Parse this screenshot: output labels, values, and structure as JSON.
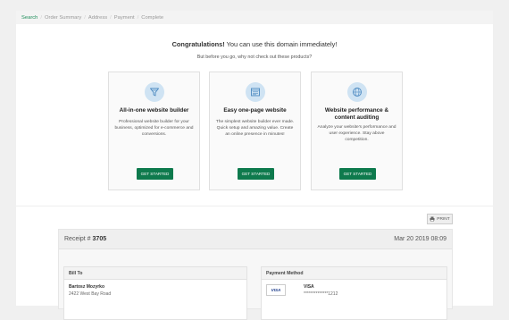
{
  "breadcrumb": [
    "Search",
    "Order Summary",
    "Address",
    "Payment",
    "Complete"
  ],
  "congrats": {
    "bold": "Congratulations!",
    "rest": " You can use this domain immediately!",
    "subline": "But before you go, why not check out these products?"
  },
  "cards": [
    {
      "icon": "funnel-icon",
      "title": "All-in-one website builder",
      "description": "Professional website builder for your business, optimized for e-commerce and conversions.",
      "button": "GET STARTED"
    },
    {
      "icon": "layout-icon",
      "title": "Easy one-page website",
      "description": "The simplest website builder ever made. Quick setup and amazing value. Create an online presence in minutes!",
      "button": "GET STARTED"
    },
    {
      "icon": "globe-icon",
      "title": "Website performance & content auditing",
      "description": "Analyze your website's performance and user experience. Stay above competition.",
      "button": "GET STARTED"
    }
  ],
  "print_label": "PRINT",
  "receipt": {
    "label": "Receipt #",
    "number": "3705",
    "date": "Mar 20 2019 08:09",
    "bill_to": {
      "title": "Bill To",
      "name": "Bartosz Mozyrko",
      "address": "2422 West Bay Road"
    },
    "payment": {
      "title": "Payment Method",
      "brand": "VISA",
      "card_logo": "VISA",
      "masked": "**************1212"
    }
  },
  "colors": {
    "accent": "#0e7a4d",
    "icon_bg": "#cfe3f3",
    "icon_fg": "#4a88c0"
  }
}
